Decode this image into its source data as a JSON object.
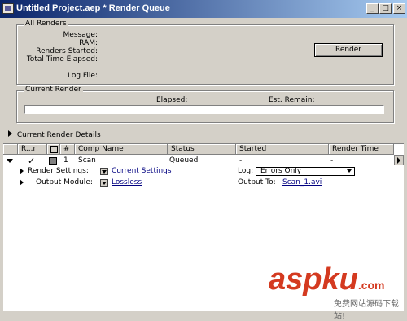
{
  "window": {
    "title": "Untitled Project.aep * Render Queue"
  },
  "caption_buttons": {
    "minimize": "_",
    "maximize": "□",
    "close": "×"
  },
  "all_renders": {
    "label": "All Renders",
    "message_label": "Message:",
    "ram_label": "RAM:",
    "renders_started_label": "Renders Started:",
    "total_time_label": "Total Time Elapsed:",
    "log_file_label": "Log File:",
    "render_button": "Render"
  },
  "current_render": {
    "label": "Current Render",
    "elapsed_label": "Elapsed:",
    "est_remain_label": "Est. Remain:"
  },
  "details_label": "Current Render Details",
  "queue": {
    "columns": [
      "R...r",
      "#",
      "Comp Name",
      "Status",
      "Started",
      "Render Time"
    ],
    "row": {
      "number": "1",
      "comp_name": "Scan",
      "status": "Queued",
      "started": "-",
      "render_time": "-"
    },
    "render_settings_label": "Render Settings:",
    "render_settings_value": "Current Settings",
    "log_label": "Log:",
    "log_value": "Errors Only",
    "output_module_label": "Output Module:",
    "output_module_value": "Lossless",
    "output_to_label": "Output To:",
    "output_to_value": "Scan_1.avi"
  },
  "watermark": {
    "text": "aspku",
    "com": ".com",
    "sub": "免费网站源码下载站!"
  }
}
